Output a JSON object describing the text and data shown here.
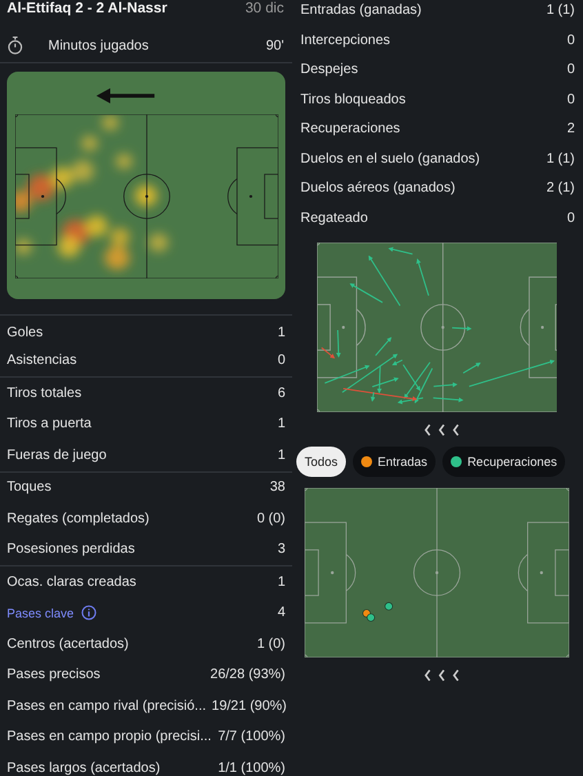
{
  "match": {
    "title": "Al-Ettifaq 2 - 2 Al-Nassr",
    "date": "30 dic"
  },
  "minutes": {
    "label": "Minutos jugados",
    "value": "90'"
  },
  "left_stats": [
    [
      {
        "label": "Goles",
        "value": "1"
      },
      {
        "label": "Asistencias",
        "value": "0"
      }
    ],
    [
      {
        "label": "Tiros totales",
        "value": "6"
      },
      {
        "label": "Tiros a puerta",
        "value": "1"
      },
      {
        "label": "Fueras de juego",
        "value": "1"
      }
    ],
    [
      {
        "label": "Toques",
        "value": "38"
      },
      {
        "label": "Regates (completados)",
        "value": "0 (0)"
      },
      {
        "label": "Posesiones perdidas",
        "value": "3"
      }
    ],
    [
      {
        "label": "Ocas. claras creadas",
        "value": "1"
      },
      {
        "label": "Pases clave",
        "value": "4",
        "kind": "link"
      },
      {
        "label": "Centros (acertados)",
        "value": "1 (0)"
      },
      {
        "label": "Pases precisos",
        "value": "26/28 (93%)"
      },
      {
        "label": "Pases en campo rival (precisió...",
        "value": "19/21 (90%)"
      },
      {
        "label": "Pases en campo propio (precisi...",
        "value": "7/7 (100%)"
      },
      {
        "label": "Pases largos (acertados)",
        "value": "1/1 (100%)"
      }
    ]
  ],
  "right_stats": [
    {
      "label": "Entradas (ganadas)",
      "value": "1 (1)"
    },
    {
      "label": "Intercepciones",
      "value": "0"
    },
    {
      "label": "Despejes",
      "value": "0"
    },
    {
      "label": "Tiros bloqueados",
      "value": "0"
    },
    {
      "label": "Recuperaciones",
      "value": "2"
    },
    {
      "label": "Duelos en el suelo (ganados)",
      "value": "1 (1)"
    },
    {
      "label": "Duelos aéreos (ganados)",
      "value": "2 (1)"
    },
    {
      "label": "Regateado",
      "value": "0"
    }
  ],
  "filters": [
    {
      "label": "Todos",
      "selected": true
    },
    {
      "label": "Entradas",
      "selected": false,
      "color": "#f08a12"
    },
    {
      "label": "Recuperaciones",
      "selected": false,
      "color": "#2fc08a"
    }
  ]
}
